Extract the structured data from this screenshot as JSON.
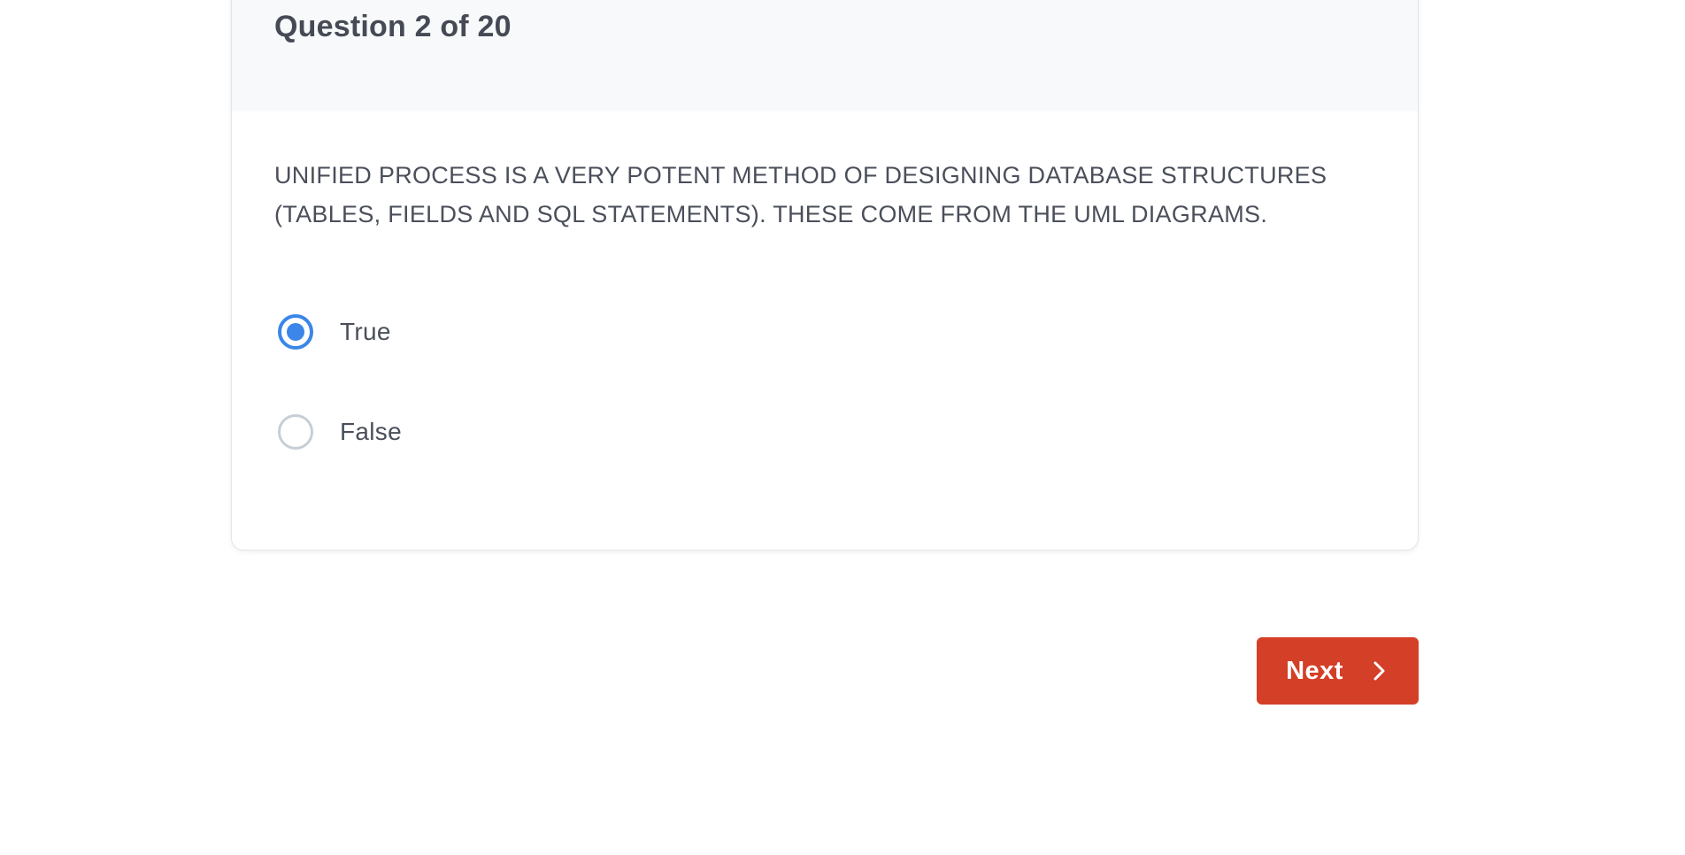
{
  "quiz": {
    "counter": "Question 2 of 20",
    "question": "UNIFIED PROCESS IS A VERY POTENT METHOD OF DESIGNING DATABASE STRUCTURES (TABLES, FIELDS AND SQL STATEMENTS). THESE COME FROM THE UML DIAGRAMS.",
    "options": [
      {
        "label": "True",
        "selected": true
      },
      {
        "label": "False",
        "selected": false
      }
    ]
  },
  "navigation": {
    "next_label": "Next",
    "next_icon": "chevron-right-icon"
  },
  "colors": {
    "accent": "#3b86e8",
    "next_button": "#d43f27",
    "header_background": "#f8f9fa",
    "text": "#4a4f5a"
  }
}
